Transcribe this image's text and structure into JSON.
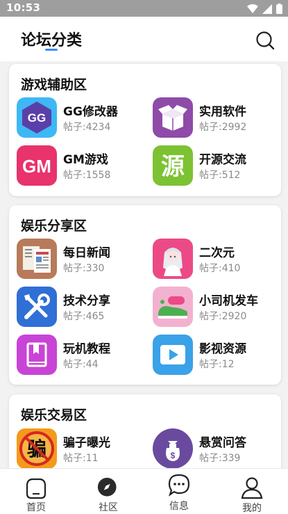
{
  "status_bar": {
    "time": "10:53"
  },
  "header": {
    "title": "论坛分类"
  },
  "sections": [
    {
      "title": "游戏辅助区",
      "items": [
        {
          "name": "GG修改器",
          "count": "帖子:4234"
        },
        {
          "name": "实用软件",
          "count": "帖子:2992"
        },
        {
          "name": "GM游戏",
          "count": "帖子:1558"
        },
        {
          "name": "开源交流",
          "count": "帖子:512"
        }
      ]
    },
    {
      "title": "娱乐分享区",
      "items": [
        {
          "name": "每日新闻",
          "count": "帖子:330"
        },
        {
          "name": "二次元",
          "count": "帖子:410"
        },
        {
          "name": "技术分享",
          "count": "帖子:465"
        },
        {
          "name": "小司机发车",
          "count": "帖子:2920"
        },
        {
          "name": "玩机教程",
          "count": "帖子:44"
        },
        {
          "name": "影视资源",
          "count": "帖子:12"
        }
      ]
    },
    {
      "title": "娱乐交易区",
      "items": [
        {
          "name": "骗子曝光",
          "count": "帖子:11"
        },
        {
          "name": "悬赏问答",
          "count": "帖子:339"
        }
      ]
    }
  ],
  "icon_text": {
    "gg": "GG",
    "gm": "GM",
    "source": "源",
    "scam": "骗"
  },
  "tabs": [
    {
      "label": "首页"
    },
    {
      "label": "社区"
    },
    {
      "label": "信息"
    },
    {
      "label": "我的"
    }
  ],
  "colors": {
    "accent": "#3b8cff",
    "status_bar": "#9e9e9e",
    "background": "#f2f2f2"
  }
}
